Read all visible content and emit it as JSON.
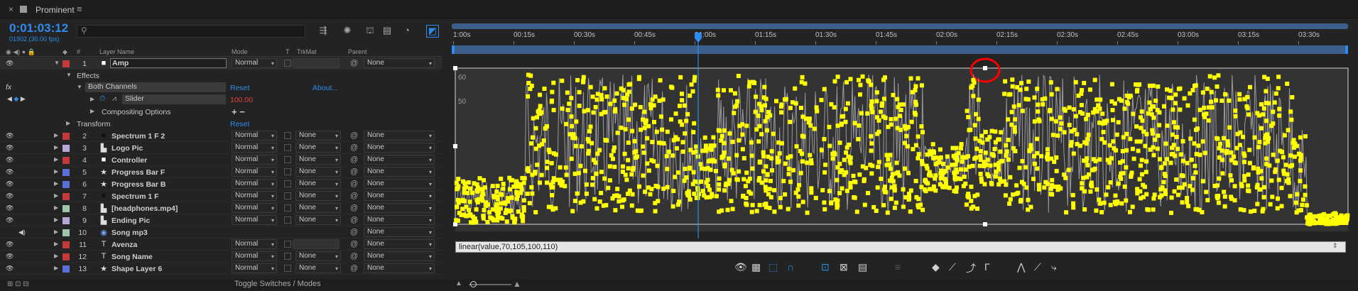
{
  "tab": {
    "title": "Prominent"
  },
  "timecode": {
    "time": "0:01:03:12",
    "frames": "01902 (30.00 fps)"
  },
  "search": {
    "placeholder": ""
  },
  "headers": {
    "num": "#",
    "layer_name": "Layer Name",
    "mode": "Mode",
    "t": "T",
    "trkmat": "TrkMat",
    "parent": "Parent"
  },
  "selected_layer": {
    "num": "1",
    "name": "Amp",
    "mode": "Normal",
    "parent": "None",
    "color": "#c33a3a"
  },
  "effects": {
    "effects_label": "Effects",
    "both_channels": "Both Channels",
    "reset": "Reset",
    "about": "About...",
    "slider_label": "Slider",
    "slider_value": "100.00",
    "compositing": "Compositing Options",
    "plus_minus": "+ −",
    "transform": "Transform",
    "transform_reset": "Reset"
  },
  "layers": [
    {
      "num": "2",
      "icon": "solid-square-icon",
      "name": "Spectrum 1 F 2",
      "mode": "Normal",
      "trkmat": "None",
      "parent": "None",
      "color": "#c33a3a",
      "type_glyph": "■",
      "type_color": "#111"
    },
    {
      "num": "3",
      "icon": "image-icon",
      "name": "Logo Pic",
      "mode": "Normal",
      "trkmat": "None",
      "parent": "None",
      "color": "#b7a7d6",
      "type_glyph": "▙",
      "type_color": "#ddd"
    },
    {
      "num": "4",
      "icon": "solid-square-icon",
      "name": "Controller",
      "mode": "Normal",
      "trkmat": "None",
      "parent": "None",
      "color": "#c33a3a",
      "type_glyph": "■",
      "type_color": "#fff"
    },
    {
      "num": "5",
      "icon": "shape-star-icon",
      "name": "Progress Bar F",
      "mode": "Normal",
      "trkmat": "None",
      "parent": "None",
      "color": "#5b6fd6",
      "type_glyph": "★",
      "type_color": "#ddd"
    },
    {
      "num": "6",
      "icon": "shape-star-icon",
      "name": "Progress Bar B",
      "mode": "Normal",
      "trkmat": "None",
      "parent": "None",
      "color": "#5b6fd6",
      "type_glyph": "★",
      "type_color": "#ddd"
    },
    {
      "num": "7",
      "icon": "solid-square-icon",
      "name": "Spectrum 1 F",
      "mode": "Normal",
      "trkmat": "None",
      "parent": "None",
      "color": "#c33a3a",
      "type_glyph": "■",
      "type_color": "#111"
    },
    {
      "num": "8",
      "icon": "footage-icon",
      "name": "[headphones.mp4]",
      "mode": "Normal",
      "trkmat": "None",
      "parent": "None",
      "color": "#9fc6a8",
      "type_glyph": "▙",
      "type_color": "#ddd"
    },
    {
      "num": "9",
      "icon": "image-icon",
      "name": "Ending Pic",
      "mode": "Normal",
      "trkmat": "None",
      "parent": "None",
      "color": "#b7a7d6",
      "type_glyph": "▙",
      "type_color": "#ddd"
    },
    {
      "num": "10",
      "icon": "audio-icon",
      "name": "Song mp3",
      "mode": "",
      "trkmat": "",
      "parent": "None",
      "color": "#9fc6a8",
      "type_glyph": "◉",
      "type_color": "#6fa0e8"
    },
    {
      "num": "11",
      "icon": "text-icon",
      "name": "Avenza",
      "mode": "Normal",
      "trkmat": "",
      "parent": "None",
      "color": "#c33a3a",
      "type_glyph": "T",
      "type_color": "#ddd"
    },
    {
      "num": "12",
      "icon": "text-icon",
      "name": "Song Name",
      "mode": "Normal",
      "trkmat": "None",
      "parent": "None",
      "color": "#c33a3a",
      "type_glyph": "T",
      "type_color": "#ddd"
    },
    {
      "num": "13",
      "icon": "shape-star-icon",
      "name": "Shape Layer 6",
      "mode": "Normal",
      "trkmat": "None",
      "parent": "None",
      "color": "#5b6fd6",
      "type_glyph": "★",
      "type_color": "#ddd"
    }
  ],
  "timeline": {
    "ticks": [
      "1:00s",
      "00:15s",
      "00:30s",
      "00:45s",
      "01:00s",
      "01:15s",
      "01:30s",
      "01:45s",
      "02:00s",
      "02:15s",
      "02:30s",
      "02:45s",
      "03:00s",
      "03:15s",
      "03:30s"
    ],
    "y_labels": [
      "60",
      "50"
    ],
    "expression": "linear(value,70,105,100,110)",
    "toggle_label": "Toggle Switches / Modes",
    "playhead_time_fraction": 0.275,
    "accent_color": "#2d8ceb",
    "curve_color": "#ffff00"
  }
}
